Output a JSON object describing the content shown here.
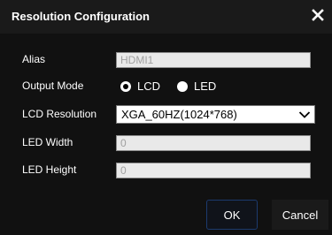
{
  "dialog": {
    "title": "Resolution Configuration",
    "close_icon": "close-icon"
  },
  "form": {
    "alias": {
      "label": "Alias",
      "value": "HDMI1"
    },
    "output_mode": {
      "label": "Output Mode",
      "options": [
        {
          "label": "LCD",
          "checked": true
        },
        {
          "label": "LED",
          "checked": false
        }
      ]
    },
    "lcd_resolution": {
      "label": "LCD Resolution",
      "value": "XGA_60HZ(1024*768)",
      "icon": "chevron-down-icon"
    },
    "led_width": {
      "label": "LED Width",
      "value": "0"
    },
    "led_height": {
      "label": "LED Height",
      "value": "0"
    }
  },
  "buttons": {
    "ok_label": "OK",
    "cancel_label": "Cancel"
  },
  "colors": {
    "background": "#000000",
    "titlebar": "#1a1a1a",
    "text": "#ffffff",
    "disabled_field": "#e9e9e9",
    "ok_border": "#1c3a6e"
  }
}
